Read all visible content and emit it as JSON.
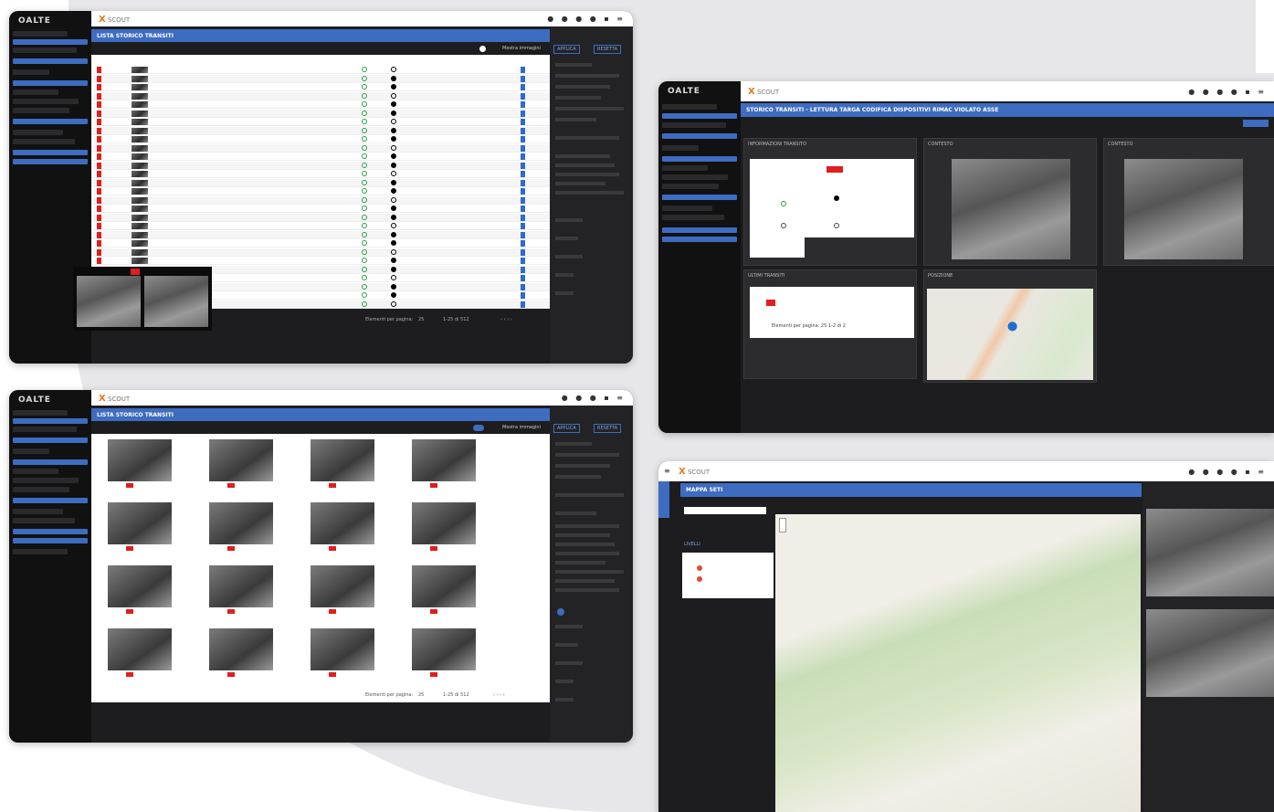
{
  "app": {
    "logo_text": "OALTE",
    "brand_name": "SCOUT",
    "toolbar_icons": [
      "user-icon",
      "bell-icon",
      "bell-icon",
      "user-icon",
      "language-icon",
      "menu-icon"
    ]
  },
  "window_list": {
    "title": "LISTA STORICO TRANSITI",
    "toggle_label": "Mostra immagini",
    "footer": {
      "rows_per_page_label": "Elementi per pagina:",
      "rows_per_page_value": "25",
      "range": "1-25 di 512"
    },
    "right_panel": {
      "buttons": [
        "APPLICA",
        "RESETTA"
      ]
    }
  },
  "window_detail": {
    "title": "STORICO TRANSITI - LETTURA TARGA CODIFICA DISPOSITIVI RIMAC VIOLATO ASSE",
    "panels": [
      "INFORMAZIONI TRANSITO",
      "CONTESTO",
      "CONTESTO",
      "ULTIMI TRANSITI",
      "POSIZIONE"
    ],
    "recent_footer": "Elementi per pagina:  25  1-2 di 2"
  },
  "window_grid": {
    "title": "LISTA STORICO TRANSITI",
    "toggle_label": "Mostra immagini",
    "footer": {
      "rows_per_page_label": "Elementi per pagina:",
      "rows_per_page_value": "25",
      "range": "1-25 di 512"
    },
    "right_panel": {
      "buttons": [
        "APPLICA",
        "RESETTA"
      ]
    }
  },
  "window_map": {
    "title": "MAPPA SETI",
    "layers_label": "LIVELLI"
  },
  "colors": {
    "accent": "#3d6cc0",
    "plate_red": "#e21d1d",
    "brand_orange": "#e07b1a",
    "dark_bg": "#1d1d1f"
  }
}
